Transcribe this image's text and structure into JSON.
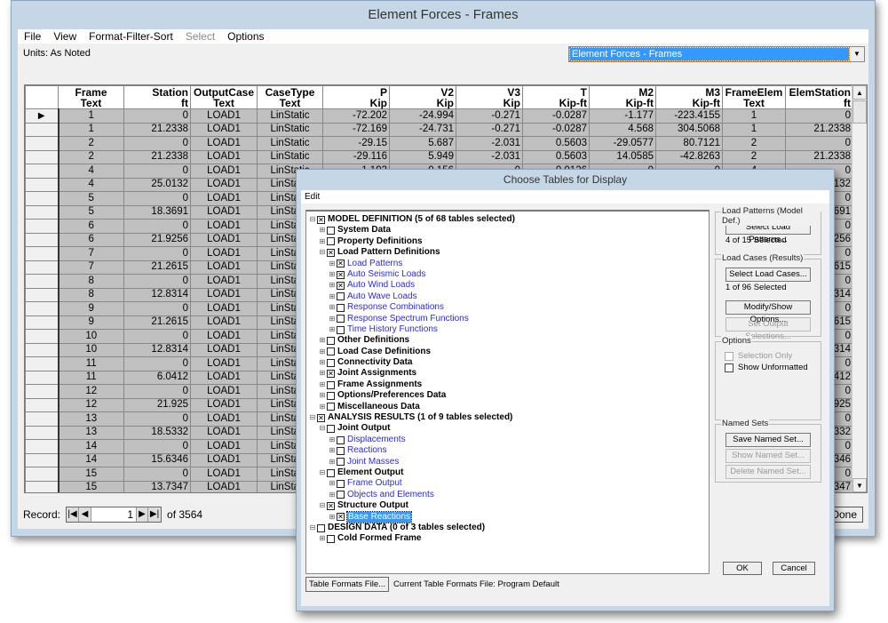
{
  "window": {
    "title": "Element Forces - Frames",
    "units": "Units: As Noted",
    "table_selector": "Element Forces - Frames",
    "done_label": "Done"
  },
  "menu": [
    {
      "label": "File",
      "enabled": true
    },
    {
      "label": "View",
      "enabled": true
    },
    {
      "label": "Format-Filter-Sort",
      "enabled": true
    },
    {
      "label": "Select",
      "enabled": false
    },
    {
      "label": "Options",
      "enabled": true
    }
  ],
  "table": {
    "columns": [
      {
        "name": "Frame",
        "unit": "Text",
        "align": "c"
      },
      {
        "name": "Station",
        "unit": "ft",
        "align": "r"
      },
      {
        "name": "OutputCase",
        "unit": "Text",
        "align": "c"
      },
      {
        "name": "CaseType",
        "unit": "Text",
        "align": "c"
      },
      {
        "name": "P",
        "unit": "Kip",
        "align": "r"
      },
      {
        "name": "V2",
        "unit": "Kip",
        "align": "r"
      },
      {
        "name": "V3",
        "unit": "Kip",
        "align": "r"
      },
      {
        "name": "T",
        "unit": "Kip-ft",
        "align": "r"
      },
      {
        "name": "M2",
        "unit": "Kip-ft",
        "align": "r"
      },
      {
        "name": "M3",
        "unit": "Kip-ft",
        "align": "r"
      },
      {
        "name": "FrameElem",
        "unit": "Text",
        "align": "c"
      },
      {
        "name": "ElemStation",
        "unit": "ft",
        "align": "r"
      }
    ],
    "rows": [
      [
        "1",
        "0",
        "LOAD1",
        "LinStatic",
        "-72.202",
        "-24.994",
        "-0.271",
        "-0.0287",
        "-1.177",
        "-223.4155",
        "1",
        "0"
      ],
      [
        "1",
        "21.2338",
        "LOAD1",
        "LinStatic",
        "-72.169",
        "-24.731",
        "-0.271",
        "-0.0287",
        "4.568",
        "304.5068",
        "1",
        "21.2338"
      ],
      [
        "2",
        "0",
        "LOAD1",
        "LinStatic",
        "-29.15",
        "5.687",
        "-2.031",
        "0.5603",
        "-29.0577",
        "80.7121",
        "2",
        "0"
      ],
      [
        "2",
        "21.2338",
        "LOAD1",
        "LinStatic",
        "-29.116",
        "5.949",
        "-2.031",
        "0.5603",
        "14.0585",
        "-42.8263",
        "2",
        "21.2338"
      ],
      [
        "4",
        "0",
        "LOAD1",
        "LinStatic",
        "1.193",
        "0.156",
        "0",
        "0.0126",
        "0",
        "0",
        "4",
        "0"
      ],
      [
        "4",
        "25.0132",
        "LOAD1",
        "LinStatic",
        "",
        "",
        "",
        "",
        "",
        "",
        "",
        "25.0132"
      ],
      [
        "5",
        "0",
        "LOAD1",
        "LinStatic",
        "",
        "",
        "",
        "",
        "",
        "",
        "",
        "0"
      ],
      [
        "5",
        "18.3691",
        "LOAD1",
        "LinStatic",
        "",
        "",
        "",
        "",
        "",
        "",
        "",
        "18.3691"
      ],
      [
        "6",
        "0",
        "LOAD1",
        "LinStatic",
        "",
        "",
        "",
        "",
        "",
        "",
        "",
        "0"
      ],
      [
        "6",
        "21.9256",
        "LOAD1",
        "LinStatic",
        "",
        "",
        "",
        "",
        "",
        "",
        "",
        "21.9256"
      ],
      [
        "7",
        "0",
        "LOAD1",
        "LinStatic",
        "",
        "",
        "",
        "",
        "",
        "",
        "",
        "0"
      ],
      [
        "7",
        "21.2615",
        "LOAD1",
        "LinStatic",
        "",
        "",
        "",
        "",
        "",
        "",
        "",
        "21.2615"
      ],
      [
        "8",
        "0",
        "LOAD1",
        "LinStatic",
        "",
        "",
        "",
        "",
        "",
        "",
        "",
        "0"
      ],
      [
        "8",
        "12.8314",
        "LOAD1",
        "LinStatic",
        "",
        "",
        "",
        "",
        "",
        "",
        "",
        "12.8314"
      ],
      [
        "9",
        "0",
        "LOAD1",
        "LinStatic",
        "",
        "",
        "",
        "",
        "",
        "",
        "",
        "0"
      ],
      [
        "9",
        "21.2615",
        "LOAD1",
        "LinStatic",
        "",
        "",
        "",
        "",
        "",
        "",
        "",
        "21.2615"
      ],
      [
        "10",
        "0",
        "LOAD1",
        "LinStatic",
        "",
        "",
        "",
        "",
        "",
        "",
        "",
        "0"
      ],
      [
        "10",
        "12.8314",
        "LOAD1",
        "LinStatic",
        "",
        "",
        "",
        "",
        "",
        "",
        "",
        "12.8314"
      ],
      [
        "11",
        "0",
        "LOAD1",
        "LinStatic",
        "",
        "",
        "",
        "",
        "",
        "",
        "",
        "0"
      ],
      [
        "11",
        "6.0412",
        "LOAD1",
        "LinStatic",
        "",
        "",
        "",
        "",
        "",
        "",
        "",
        "6.0412"
      ],
      [
        "12",
        "0",
        "LOAD1",
        "LinStatic",
        "",
        "",
        "",
        "",
        "",
        "",
        "",
        "0"
      ],
      [
        "12",
        "21.925",
        "LOAD1",
        "LinStatic",
        "",
        "",
        "",
        "",
        "",
        "",
        "",
        "21.925"
      ],
      [
        "13",
        "0",
        "LOAD1",
        "LinStatic",
        "",
        "",
        "",
        "",
        "",
        "",
        "",
        "0"
      ],
      [
        "13",
        "18.5332",
        "LOAD1",
        "LinStatic",
        "",
        "",
        "",
        "",
        "",
        "",
        "",
        "18.5332"
      ],
      [
        "14",
        "0",
        "LOAD1",
        "LinStatic",
        "",
        "",
        "",
        "",
        "",
        "",
        "",
        "0"
      ],
      [
        "14",
        "15.6346",
        "LOAD1",
        "LinStatic",
        "",
        "",
        "",
        "",
        "",
        "",
        "",
        "15.6346"
      ],
      [
        "15",
        "0",
        "LOAD1",
        "LinStatic",
        "",
        "",
        "",
        "",
        "",
        "",
        "",
        "0"
      ],
      [
        "15",
        "13.7347",
        "LOAD1",
        "LinStatic",
        "",
        "",
        "",
        "",
        "",
        "",
        "",
        "13.7347"
      ]
    ]
  },
  "record": {
    "label": "Record:",
    "current": "1",
    "of": "of 3564"
  },
  "dialog": {
    "title": "Choose Tables for Display",
    "menu": "Edit",
    "tree": [
      {
        "level": 0,
        "label": "MODEL DEFINITION  (5 of 68 tables selected)",
        "checked": true,
        "expanded": true
      },
      {
        "level": 1,
        "label": "System Data",
        "checked": false
      },
      {
        "level": 1,
        "label": "Property Definitions",
        "checked": false
      },
      {
        "level": 1,
        "label": "Load Pattern Definitions",
        "checked": true,
        "expanded": true
      },
      {
        "level": 2,
        "label": "Load Patterns",
        "checked": true
      },
      {
        "level": 2,
        "label": "Auto Seismic Loads",
        "checked": true
      },
      {
        "level": 2,
        "label": "Auto Wind Loads",
        "checked": true
      },
      {
        "level": 2,
        "label": "Auto Wave Loads",
        "checked": false
      },
      {
        "level": 2,
        "label": "Response Combinations",
        "checked": false
      },
      {
        "level": 2,
        "label": "Response Spectrum Functions",
        "checked": false
      },
      {
        "level": 2,
        "label": "Time History Functions",
        "checked": false
      },
      {
        "level": 1,
        "label": "Other Definitions",
        "checked": false
      },
      {
        "level": 1,
        "label": "Load Case Definitions",
        "checked": false
      },
      {
        "level": 1,
        "label": "Connectivity Data",
        "checked": false
      },
      {
        "level": 1,
        "label": "Joint Assignments",
        "checked": true
      },
      {
        "level": 1,
        "label": "Frame Assignments",
        "checked": false
      },
      {
        "level": 1,
        "label": "Options/Preferences Data",
        "checked": false
      },
      {
        "level": 1,
        "label": "Miscellaneous Data",
        "checked": false
      },
      {
        "level": 0,
        "label": "ANALYSIS RESULTS  (1 of 9 tables selected)",
        "checked": true,
        "expanded": true
      },
      {
        "level": 1,
        "label": "Joint Output",
        "checked": false,
        "expanded": true
      },
      {
        "level": 2,
        "label": "Displacements",
        "checked": false
      },
      {
        "level": 2,
        "label": "Reactions",
        "checked": false
      },
      {
        "level": 2,
        "label": "Joint Masses",
        "checked": false
      },
      {
        "level": 1,
        "label": "Element Output",
        "checked": false,
        "expanded": true
      },
      {
        "level": 2,
        "label": "Frame Output",
        "checked": false
      },
      {
        "level": 2,
        "label": "Objects and Elements",
        "checked": false
      },
      {
        "level": 1,
        "label": "Structure Output",
        "checked": true,
        "expanded": true
      },
      {
        "level": 2,
        "label": "Base Reactions",
        "checked": true,
        "selected": true
      },
      {
        "level": 0,
        "label": "DESIGN DATA  (0 of 3 tables selected)",
        "checked": false,
        "expanded": true
      },
      {
        "level": 1,
        "label": "Cold Formed Frame",
        "checked": false
      }
    ],
    "load_patterns": {
      "title": "Load Patterns (Model Def.)",
      "button": "Select Load Patterns...",
      "status": "4 of 15 Selected"
    },
    "load_cases": {
      "title": "Load Cases (Results)",
      "button": "Select Load Cases...",
      "status": "1 of 96 Selected",
      "modify": "Modify/Show Options...",
      "set_output": "Set Output Selections..."
    },
    "options": {
      "title": "Options",
      "selection_only": "Selection Only",
      "show_unformatted": "Show Unformatted"
    },
    "named_sets": {
      "title": "Named Sets",
      "save": "Save Named Set...",
      "show": "Show Named Set...",
      "delete": "Delete Named Set..."
    },
    "ok": "OK",
    "cancel": "Cancel",
    "table_formats_button": "Table Formats File...",
    "table_formats_label": "Current Table Formats File:  Program Default"
  }
}
